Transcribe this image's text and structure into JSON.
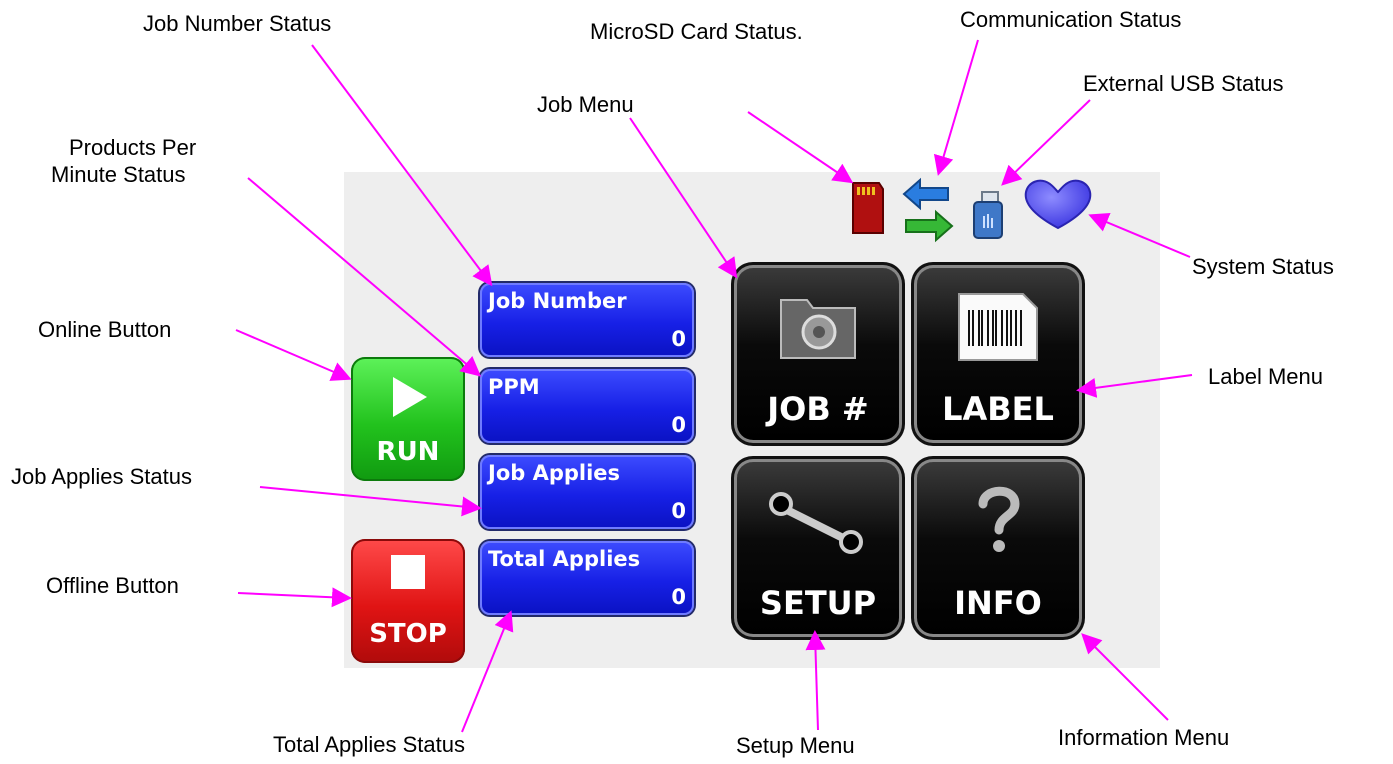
{
  "callouts": {
    "job_number_status": "Job Number Status",
    "microsd_status": "MicroSD Card Status.",
    "communication_status": "Communication Status",
    "external_usb_status": "External USB Status",
    "job_menu": "Job Menu",
    "products_per_minute_status_line1": "Products Per",
    "products_per_minute_status_line2": "Minute Status",
    "system_status": "System Status",
    "online_button": "Online Button",
    "label_menu": "Label Menu",
    "job_applies_status": "Job Applies Status",
    "offline_button": "Offline Button",
    "total_applies_status": "Total Applies Status",
    "setup_menu": "Setup Menu",
    "information_menu": "Information Menu"
  },
  "buttons": {
    "run_label": "RUN",
    "stop_label": "STOP"
  },
  "status_fields": [
    {
      "title": "Job Number",
      "value": "0"
    },
    {
      "title": "PPM",
      "value": "0"
    },
    {
      "title": "Job Applies",
      "value": "0"
    },
    {
      "title": "Total Applies",
      "value": "0"
    }
  ],
  "menus": {
    "job_label": "JOB #",
    "label_label": "LABEL",
    "setup_label": "SETUP",
    "info_label": "INFO"
  },
  "icons": {
    "microsd": "microsd-card-icon",
    "communication": "sync-arrows-icon",
    "usb": "usb-drive-icon",
    "system": "heart-icon"
  },
  "colors": {
    "run": "#22c21d",
    "stop": "#e01414",
    "status_bg": "#1720e6",
    "callout_arrow": "#ff00ff",
    "heart": "#4a44ee"
  }
}
